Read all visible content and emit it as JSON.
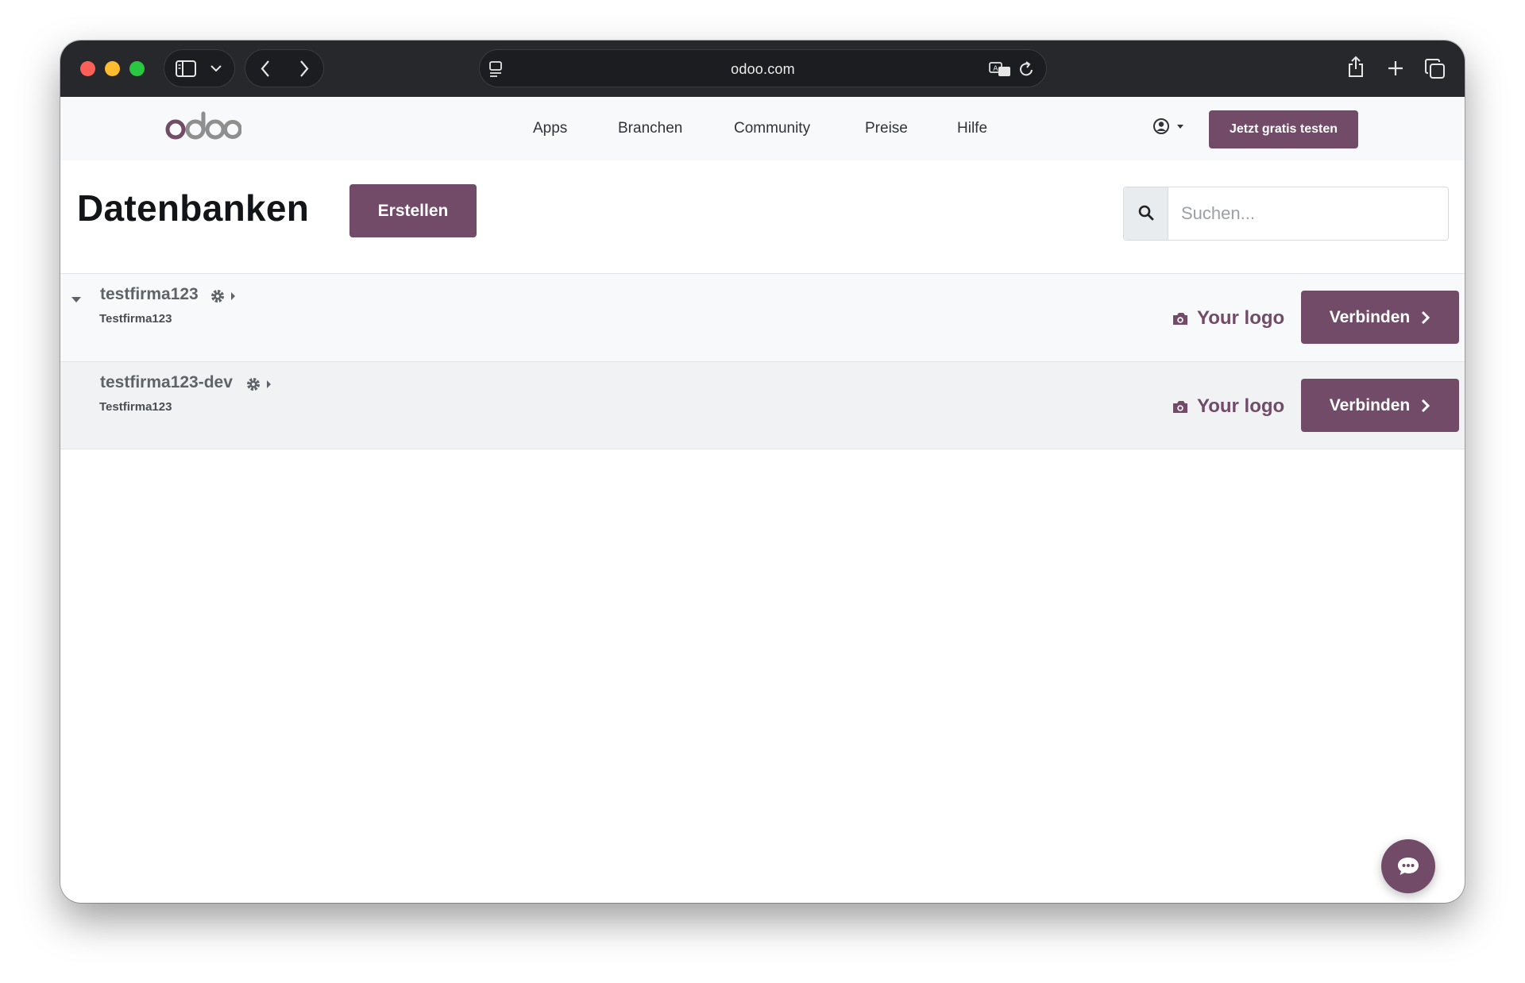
{
  "browser": {
    "url": "odoo.com"
  },
  "header": {
    "logo_text": "odoo",
    "nav": [
      "Apps",
      "Branchen",
      "Community",
      "Preise",
      "Hilfe"
    ],
    "cta_label": "Jetzt gratis testen"
  },
  "page": {
    "title": "Datenbanken",
    "create_label": "Erstellen",
    "search_placeholder": "Suchen..."
  },
  "databases": [
    {
      "name": "testfirma123",
      "company": "Testfirma123",
      "logo_label": "Your logo",
      "connect_label": "Verbinden"
    },
    {
      "name": "testfirma123-dev",
      "company": "Testfirma123",
      "logo_label": "Your logo",
      "connect_label": "Verbinden"
    }
  ],
  "colors": {
    "brand": "#714b67",
    "toolbar": "#26282c"
  }
}
